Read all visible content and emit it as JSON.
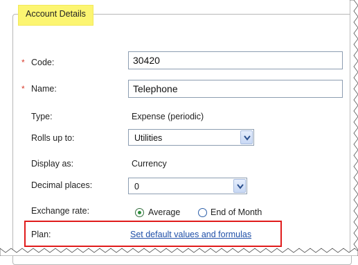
{
  "legend": "Account Details",
  "code": {
    "required_mark": "*",
    "label": "Code:",
    "value": "30420"
  },
  "name": {
    "required_mark": "*",
    "label": "Name:",
    "value": "Telephone"
  },
  "type": {
    "label": "Type:",
    "value": "Expense (periodic)"
  },
  "rolls_up_to": {
    "label": "Rolls up to:",
    "selected": "Utilities"
  },
  "display_as": {
    "label": "Display as:",
    "value": "Currency"
  },
  "decimal_places": {
    "label": "Decimal places:",
    "selected": "0"
  },
  "exchange_rate": {
    "label": "Exchange rate:",
    "options": [
      {
        "label": "Average",
        "selected": true
      },
      {
        "label": "End of Month",
        "selected": false
      }
    ]
  },
  "plan": {
    "label": "Plan:",
    "link": "Set default values and formulas"
  },
  "colors": {
    "legend_bg": "#fcf571",
    "highlight": "#e01b1b",
    "link": "#1f4fa8",
    "required": "#d83b2b"
  }
}
